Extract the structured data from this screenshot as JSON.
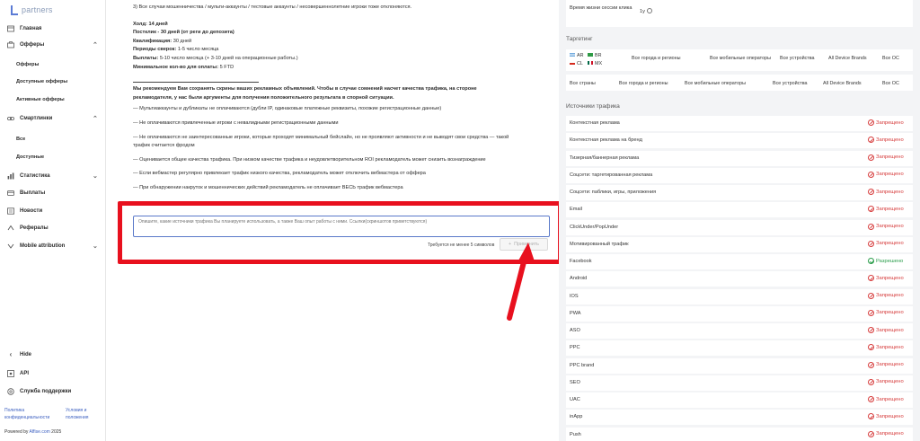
{
  "app": {
    "logo_text": "partners"
  },
  "sidebar": {
    "items": [
      {
        "label": "Главная",
        "icon": "home-icon"
      },
      {
        "label": "Офферы",
        "icon": "briefcase-icon",
        "expanded": true
      },
      {
        "label": "Смартлинки",
        "icon": "link-icon",
        "expanded": true
      },
      {
        "label": "Статистика",
        "icon": "chart-icon"
      },
      {
        "label": "Выплаты",
        "icon": "wallet-icon"
      },
      {
        "label": "Новости",
        "icon": "news-icon"
      },
      {
        "label": "Рефералы",
        "icon": "referral-icon"
      },
      {
        "label": "Mobile attribution",
        "icon": "mobile-icon"
      }
    ],
    "offers_sub": [
      "Офферы",
      "Доступные офферы",
      "Активные офферы"
    ],
    "smartlinks_sub": [
      "Все",
      "Доступные"
    ],
    "hide_label": "Hide",
    "api_label": "API",
    "support_label": "Служба поддержки",
    "privacy_label": "Политика конфиденциальности",
    "terms_label": "Условия и положения",
    "powered_prefix": "Powered by",
    "powered_brand": "Affise.com",
    "powered_year": "2025"
  },
  "main": {
    "line_fraud": "3) Все случаи мошенничества / мульти-аккаунты / тестовые аккаунты / несовершеннолетние игроки тоже отклоняются.",
    "hold": "Холд: 14 дней",
    "postclick": "Постклик - 30 дней (от реги до депозита)",
    "qual_label": "Квалификация:",
    "qual_value": "30 дней",
    "periods_label": "Периоды сверок:",
    "periods_value": "1-5 число месяца",
    "payouts_label": "Выплаты:",
    "payouts_value": "5-10 число месяца  (+ 3-10 дней на операционные работы.)",
    "min_label": "Минимальное кол-во для оплаты:",
    "min_value": "5 FTD",
    "recommend": "Мы рекомендуем Вам сохранять скрины ваших рекламных объявлений. Чтобы в случае сомнений насчет качества трафика, на стороне рекламодателя, у нас были аргументы для получения положительного результата в спорной ситуации.",
    "bullets": [
      "— Мультиаккаунты и дубликаты не оплачиваются (дубли IP, одинаковые платежные реквизиты, похожие регистрационные данные)",
      "— Не оплачиваются привлеченные игроки с невалидными регистрационными данными",
      "— Не оплачиваются не заинтересованные игроки, которые проходят минимальный бейслайн, но не проявляют активности и не выводят свои средства — такой трафик считается фродом",
      "— Оценивается общее качества трафика. При низком качестве трафика и неудовлетворительном ROI рекламодатель может снизить вознаграждение",
      "— Если вебмастер регулярно привлекает трафик низкого качества, рекламодатель может отключить вебмастера от оффера",
      "— При обнаружении накруток и мошеннических действий рекламодатель не оплачивает ВЕСЬ трафик вебмастера"
    ],
    "comment_placeholder": "Опишите, какие источники трафика Вы планируете использовать, а также Ваш опыт работы с ними. Ссылки(скриншотов приветствуются)",
    "comment_hint": "Требуется не менее 5 символов",
    "apply_label": "Применить",
    "highlight_color": "#e8101e"
  },
  "right": {
    "session_label": "Время жизни сессии клика",
    "session_value": "1y",
    "targeting_title": "Таргетинг",
    "targeting_row1": {
      "countries": [
        "AR",
        "BR",
        "CL",
        "MX"
      ],
      "cities": "Все города и регионы",
      "operators": "Все мобильные операторы",
      "devices": "Все устройства",
      "brands": "All Device Brands",
      "os": "Все ОС"
    },
    "targeting_row2": {
      "countries": "Все страны",
      "cities": "Все города и регионы",
      "operators": "Все мобильные операторы",
      "devices": "Все устройства",
      "brands": "All Device Brands",
      "os": "Все ОС"
    },
    "sources_title": "Источники трафика",
    "sources": [
      {
        "name": "Контекстная реклама",
        "status": "Запрещено",
        "allowed": false
      },
      {
        "name": "Контекстная реклама на бренд",
        "status": "Запрещено",
        "allowed": false
      },
      {
        "name": "Тизерная/баннерная реклама",
        "status": "Запрещено",
        "allowed": false
      },
      {
        "name": "Соцсети: таргетированная реклама",
        "status": "Запрещено",
        "allowed": false
      },
      {
        "name": "Соцсети: паблики, игры, приложения",
        "status": "Запрещено",
        "allowed": false
      },
      {
        "name": "Email",
        "status": "Запрещено",
        "allowed": false
      },
      {
        "name": "ClickUnder/PopUnder",
        "status": "Запрещено",
        "allowed": false
      },
      {
        "name": "Мотивированный трафик",
        "status": "Запрещено",
        "allowed": false
      },
      {
        "name": "Facebook",
        "status": "Разрешено",
        "allowed": true
      },
      {
        "name": "Android",
        "status": "Запрещено",
        "allowed": false
      },
      {
        "name": "IOS",
        "status": "Запрещено",
        "allowed": false
      },
      {
        "name": "PWA",
        "status": "Запрещено",
        "allowed": false
      },
      {
        "name": "ASO",
        "status": "Запрещено",
        "allowed": false
      },
      {
        "name": "PPC",
        "status": "Запрещено",
        "allowed": false
      },
      {
        "name": "PPC brand",
        "status": "Запрещено",
        "allowed": false
      },
      {
        "name": "SEO",
        "status": "Запрещено",
        "allowed": false
      },
      {
        "name": "UAC",
        "status": "Запрещено",
        "allowed": false
      },
      {
        "name": "inApp",
        "status": "Запрещено",
        "allowed": false
      },
      {
        "name": "Push",
        "status": "Запрещено",
        "allowed": false
      }
    ]
  }
}
